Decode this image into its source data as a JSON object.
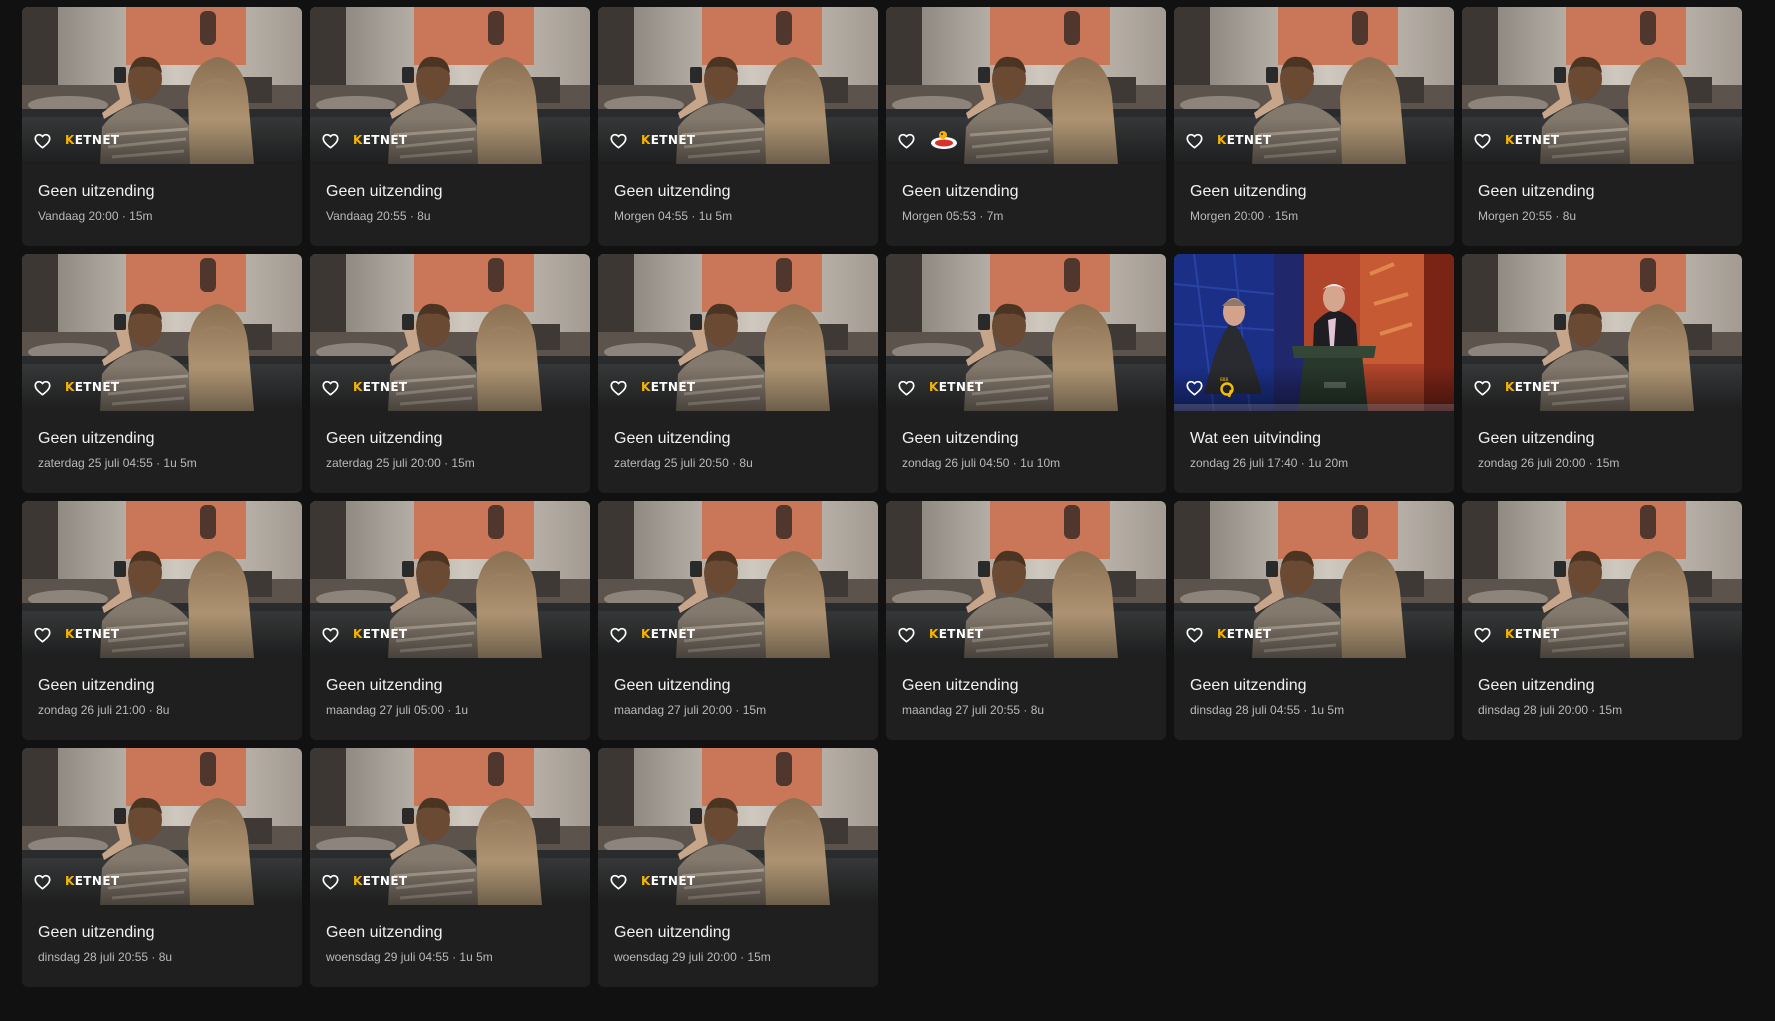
{
  "icons": {
    "favorite": "heart-outline-icon"
  },
  "colors": {
    "background": "#111111",
    "card": "#1f1f1f",
    "title_text": "#f1f1f1",
    "meta_text": "#b9b9b9",
    "ketnet_accent": "#f7b500"
  },
  "logos": {
    "ketnet": {
      "accent_letter": "K",
      "rest": "ETNET"
    }
  },
  "cards": [
    {
      "title": "Geen uitzending",
      "meta": "Vandaag 20:00 · 15m",
      "channel": "ketnet",
      "image": "couch"
    },
    {
      "title": "Geen uitzending",
      "meta": "Vandaag 20:55 · 8u",
      "channel": "ketnet",
      "image": "couch"
    },
    {
      "title": "Geen uitzending",
      "meta": "Morgen 04:55 · 1u 5m",
      "channel": "ketnet",
      "image": "couch"
    },
    {
      "title": "Geen uitzending",
      "meta": "Morgen 05:53 · 7m",
      "channel": "junior",
      "image": "couch"
    },
    {
      "title": "Geen uitzending",
      "meta": "Morgen 20:00 · 15m",
      "channel": "ketnet",
      "image": "couch"
    },
    {
      "title": "Geen uitzending",
      "meta": "Morgen 20:55 · 8u",
      "channel": "ketnet",
      "image": "couch"
    },
    {
      "title": "Geen uitzending",
      "meta": "zaterdag 25 juli 04:55 · 1u 5m",
      "channel": "ketnet",
      "image": "couch"
    },
    {
      "title": "Geen uitzending",
      "meta": "zaterdag 25 juli 20:00 · 15m",
      "channel": "ketnet",
      "image": "couch"
    },
    {
      "title": "Geen uitzending",
      "meta": "zaterdag 25 juli 20:50 · 8u",
      "channel": "ketnet",
      "image": "couch"
    },
    {
      "title": "Geen uitzending",
      "meta": "zondag 26 juli 04:50 · 1u 10m",
      "channel": "ketnet",
      "image": "couch"
    },
    {
      "title": "Wat een uitvinding",
      "meta": "zondag 26 juli 17:40 · 1u 20m",
      "channel": "canvas",
      "image": "studio"
    },
    {
      "title": "Geen uitzending",
      "meta": "zondag 26 juli 20:00 · 15m",
      "channel": "ketnet",
      "image": "couch"
    },
    {
      "title": "Geen uitzending",
      "meta": "zondag 26 juli 21:00 · 8u",
      "channel": "ketnet",
      "image": "couch"
    },
    {
      "title": "Geen uitzending",
      "meta": "maandag 27 juli 05:00 · 1u",
      "channel": "ketnet",
      "image": "couch"
    },
    {
      "title": "Geen uitzending",
      "meta": "maandag 27 juli 20:00 · 15m",
      "channel": "ketnet",
      "image": "couch"
    },
    {
      "title": "Geen uitzending",
      "meta": "maandag 27 juli 20:55 · 8u",
      "channel": "ketnet",
      "image": "couch"
    },
    {
      "title": "Geen uitzending",
      "meta": "dinsdag 28 juli 04:55 · 1u 5m",
      "channel": "ketnet",
      "image": "couch"
    },
    {
      "title": "Geen uitzending",
      "meta": "dinsdag 28 juli 20:00 · 15m",
      "channel": "ketnet",
      "image": "couch"
    },
    {
      "title": "Geen uitzending",
      "meta": "dinsdag 28 juli 20:55 · 8u",
      "channel": "ketnet",
      "image": "couch"
    },
    {
      "title": "Geen uitzending",
      "meta": "woensdag 29 juli 04:55 · 1u 5m",
      "channel": "ketnet",
      "image": "couch"
    },
    {
      "title": "Geen uitzending",
      "meta": "woensdag 29 juli 20:00 · 15m",
      "channel": "ketnet",
      "image": "couch"
    }
  ]
}
